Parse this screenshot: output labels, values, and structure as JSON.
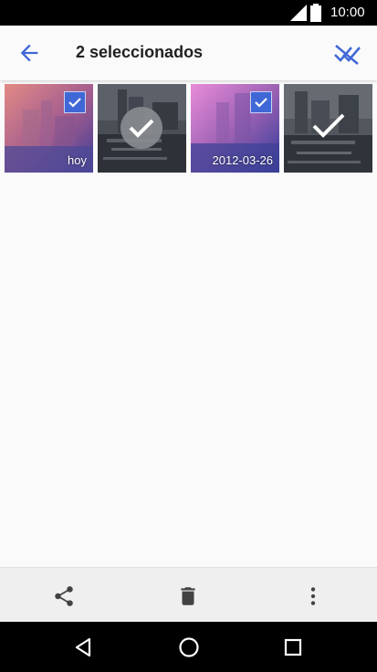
{
  "status_bar": {
    "time": "10:00",
    "icons": [
      "signal-icon",
      "battery-icon"
    ]
  },
  "app_bar": {
    "title": "2 seleccionados",
    "icons": [
      "back-arrow-icon",
      "deselect-all-icon"
    ]
  },
  "photos": [
    {
      "label": "hoy",
      "selected": true,
      "tint": "pink-blue"
    },
    {
      "label": "",
      "selected": false,
      "tint": "dark",
      "overlay": "check-circle"
    },
    {
      "label": "2012-03-26",
      "selected": true,
      "tint": "magenta-blue"
    },
    {
      "label": "",
      "selected": false,
      "tint": "dark",
      "overlay": "check"
    }
  ],
  "bottom_bar": {
    "icons": [
      "share-icon",
      "trash-icon",
      "more-vert-icon"
    ]
  },
  "nav_bar": {
    "icons": [
      "back-triangle-icon",
      "home-circle-icon",
      "recents-square-icon"
    ]
  },
  "colors": {
    "accent": "#3f67d6",
    "background": "#fafafa",
    "bar": "#efefef"
  }
}
